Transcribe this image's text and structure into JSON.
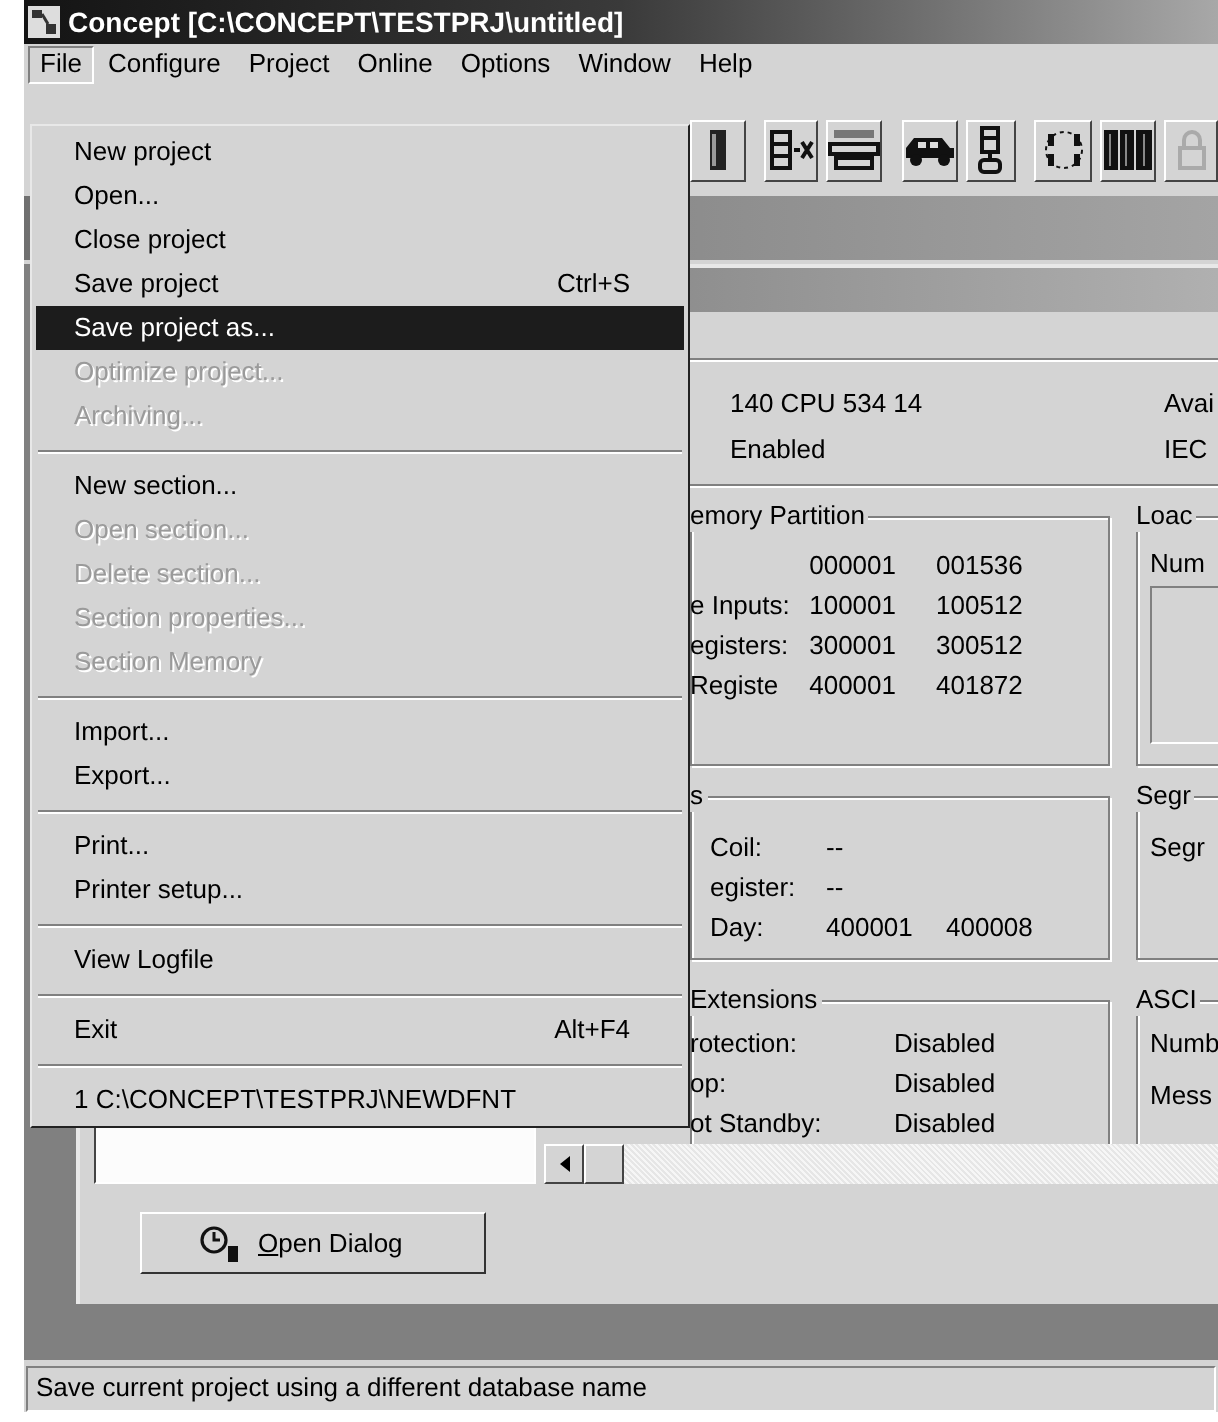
{
  "window": {
    "title": "Concept [C:\\CONCEPT\\TESTPRJ\\untitled]"
  },
  "menubar": [
    {
      "label": "File",
      "selected": true
    },
    {
      "label": "Configure",
      "selected": false
    },
    {
      "label": "Project",
      "selected": false
    },
    {
      "label": "Online",
      "selected": false
    },
    {
      "label": "Options",
      "selected": false
    },
    {
      "label": "Window",
      "selected": false
    },
    {
      "label": "Help",
      "selected": false
    }
  ],
  "file_menu": [
    {
      "kind": "item",
      "label": "New project",
      "disabled": false,
      "selected": false
    },
    {
      "kind": "item",
      "label": "Open...",
      "disabled": false,
      "selected": false
    },
    {
      "kind": "item",
      "label": "Close project",
      "disabled": false,
      "selected": false
    },
    {
      "kind": "item",
      "label": "Save project",
      "shortcut": "Ctrl+S",
      "disabled": false,
      "selected": false
    },
    {
      "kind": "item",
      "label": "Save project as...",
      "disabled": false,
      "selected": true
    },
    {
      "kind": "item",
      "label": "Optimize project...",
      "disabled": true,
      "selected": false
    },
    {
      "kind": "item",
      "label": "Archiving...",
      "disabled": true,
      "selected": false
    },
    {
      "kind": "separator"
    },
    {
      "kind": "item",
      "label": "New section...",
      "disabled": false,
      "selected": false
    },
    {
      "kind": "item",
      "label": "Open section...",
      "disabled": true,
      "selected": false
    },
    {
      "kind": "item",
      "label": "Delete section...",
      "disabled": true,
      "selected": false
    },
    {
      "kind": "item",
      "label": "Section properties...",
      "disabled": true,
      "selected": false
    },
    {
      "kind": "item",
      "label": "Section Memory",
      "disabled": true,
      "selected": false
    },
    {
      "kind": "separator"
    },
    {
      "kind": "item",
      "label": "Import...",
      "disabled": false,
      "selected": false
    },
    {
      "kind": "item",
      "label": "Export...",
      "disabled": false,
      "selected": false
    },
    {
      "kind": "separator"
    },
    {
      "kind": "item",
      "label": "Print...",
      "disabled": false,
      "selected": false
    },
    {
      "kind": "item",
      "label": "Printer setup...",
      "disabled": false,
      "selected": false
    },
    {
      "kind": "separator"
    },
    {
      "kind": "item",
      "label": "View Logfile",
      "disabled": false,
      "selected": false
    },
    {
      "kind": "separator"
    },
    {
      "kind": "item",
      "label": "Exit",
      "shortcut": "Alt+F4",
      "disabled": false,
      "selected": false
    },
    {
      "kind": "separator"
    },
    {
      "kind": "item",
      "label": "1 C:\\CONCEPT\\TESTPRJ\\NEWDFNT",
      "disabled": false,
      "selected": false
    }
  ],
  "cpu_panel": {
    "cpu": "140 CPU 534 14",
    "state": "Enabled",
    "column_2_line_1": "Avai",
    "column_2_line_2": "IEC"
  },
  "memory_partition": {
    "legend": "emory Partition",
    "rows": [
      {
        "start": "000001",
        "end": "001536"
      },
      {
        "label": "e Inputs:",
        "start": "100001",
        "end": "100512"
      },
      {
        "label": "egisters:",
        "start": "300001",
        "end": "300512"
      },
      {
        "label": "Registe",
        "start": "400001",
        "end": "401872"
      }
    ]
  },
  "load_group": {
    "legend": "Loac",
    "label": "Num"
  },
  "group_3": {
    "legend": "s",
    "rows": [
      {
        "label": "Coil:",
        "start": "--"
      },
      {
        "label": "egister:",
        "start": "--"
      },
      {
        "label": "Day:",
        "start": "400001",
        "end": "400008"
      }
    ]
  },
  "segment_group": {
    "legend": "Segr",
    "label": "Segr"
  },
  "extensions": {
    "legend": "Extensions",
    "rows": [
      {
        "label": "rotection:",
        "value": "Disabled"
      },
      {
        "label": "op:",
        "value": "Disabled"
      },
      {
        "label": "ot Standby:",
        "value": "Disabled"
      }
    ]
  },
  "ascii_group": {
    "legend": "ASCI",
    "labels": [
      "Numb",
      "Mess"
    ]
  },
  "open_dialog_button": {
    "label": "Open Dialog"
  },
  "status_bar": "Save current project using a different database name"
}
